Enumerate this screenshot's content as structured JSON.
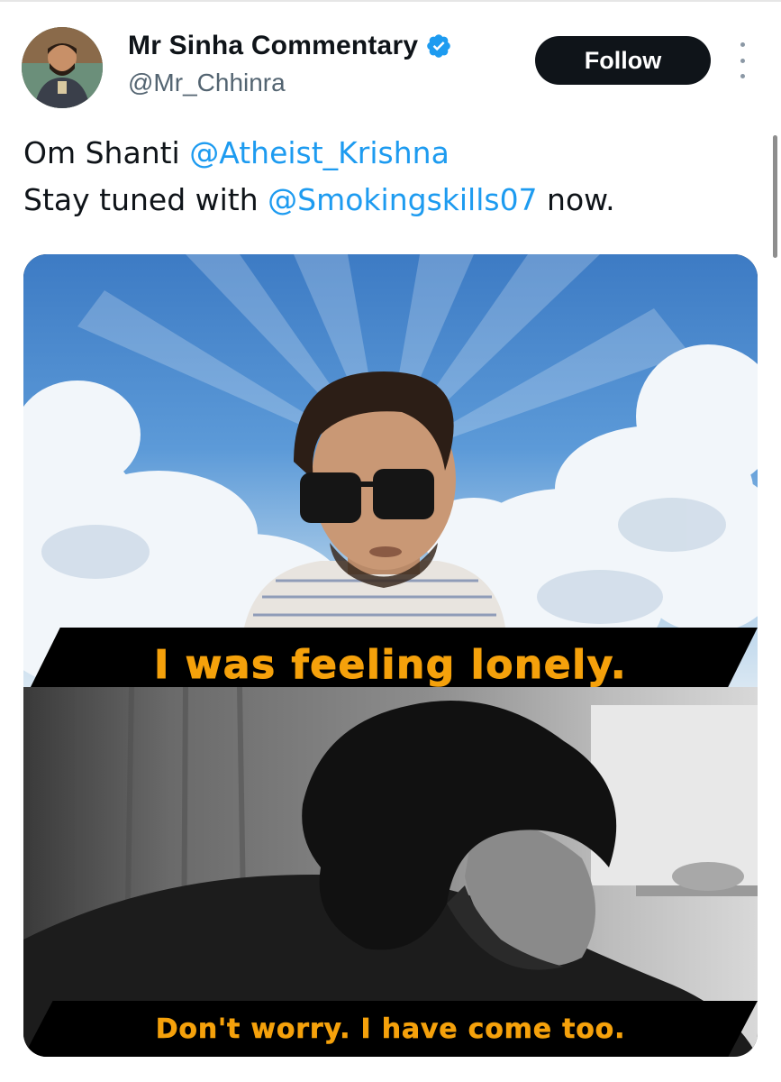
{
  "tweet": {
    "author": {
      "display_name": "Mr Sinha Commentary",
      "handle": "@Mr_Chhinra",
      "verified": true,
      "verified_icon": "verified-badge-icon"
    },
    "follow_label": "Follow",
    "more_icon": "more-vertical-icon",
    "text": {
      "line1_prefix": "Om Shanti ",
      "line1_mention": "@Atheist_Krishna",
      "line2_prefix": "Stay tuned with ",
      "line2_mention": "@Smokingskills07",
      "line2_suffix": " now."
    },
    "media": {
      "caption_top": "I was feeling lonely.",
      "caption_bottom": "Don't worry. I have come too."
    }
  },
  "colors": {
    "accent_link": "#1d9bf0",
    "follow_bg": "#0f1419",
    "verified": "#1d9bf0",
    "caption_text": "#f5a10b",
    "secondary_text": "#536471"
  }
}
